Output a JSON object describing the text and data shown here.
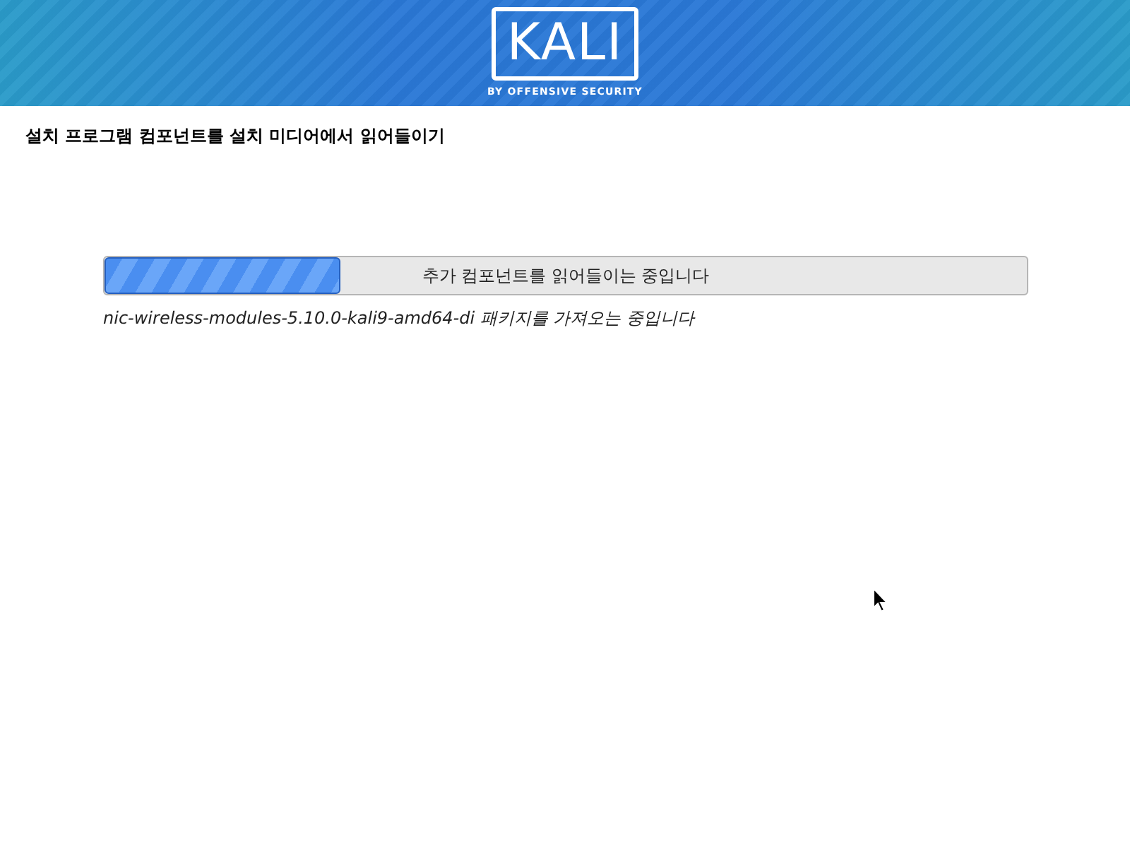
{
  "banner": {
    "logo": {
      "wordmark": "KALI",
      "tagline": "BY OFFENSIVE SECURITY"
    }
  },
  "title": "설치 프로그램 컴포넌트를 설치 미디어에서 읽어들이기",
  "progress": {
    "level": 0.255,
    "label": "추가 컴포넌트를 읽어들이는 중입니다"
  },
  "status": "nic-wireless-modules-5.10.0-kali9-amd64-di 패키지를 가져오는 중입니다"
}
